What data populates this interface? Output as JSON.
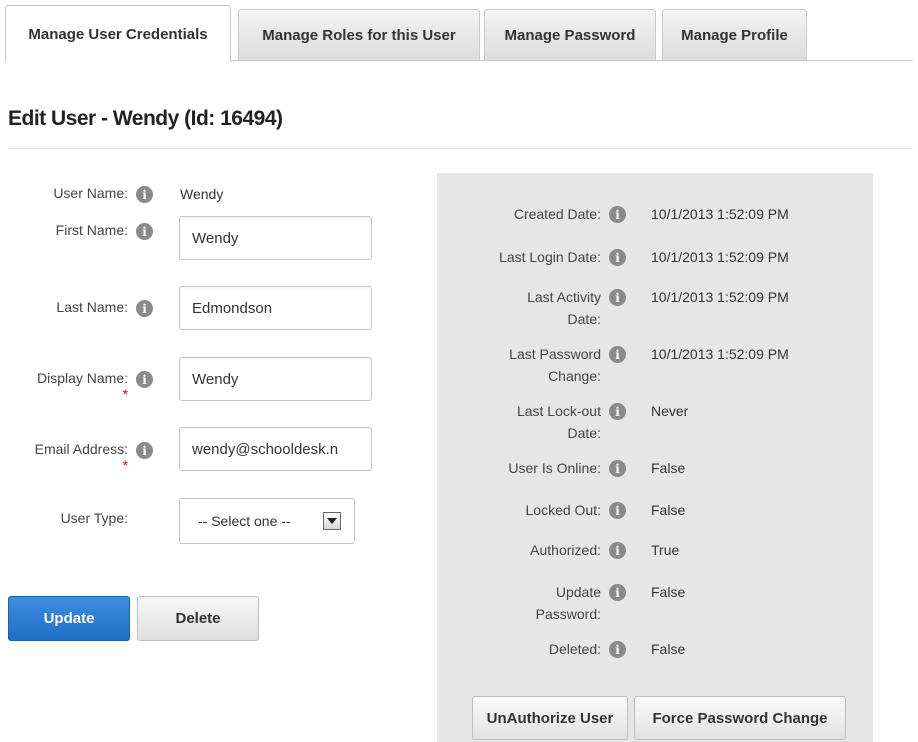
{
  "tabs": [
    {
      "label": "Manage User Credentials",
      "active": true
    },
    {
      "label": "Manage Roles for this User",
      "active": false
    },
    {
      "label": "Manage Password",
      "active": false
    },
    {
      "label": "Manage Profile",
      "active": false
    }
  ],
  "page_title": "Edit User - Wendy (Id: 16494)",
  "form": {
    "user_name": {
      "label": "User Name:",
      "value": "Wendy"
    },
    "first_name": {
      "label": "First Name:",
      "value": "Wendy"
    },
    "last_name": {
      "label": "Last Name:",
      "value": "Edmondson"
    },
    "display_name": {
      "label": "Display Name:",
      "value": "Wendy",
      "required": "*"
    },
    "email": {
      "label": "Email Address:",
      "value": "wendy@schooldesk.n",
      "required": "*"
    },
    "user_type": {
      "label": "User Type:",
      "selected": "-- Select one --"
    },
    "info_glyph": "i"
  },
  "actions": {
    "update": "Update",
    "delete": "Delete"
  },
  "details": {
    "created_date": {
      "label": "Created Date:",
      "value": "10/1/2013 1:52:09 PM"
    },
    "last_login_date": {
      "label": "Last Login Date:",
      "value": "10/1/2013 1:52:09 PM"
    },
    "last_activity_date": {
      "label_line1": "Last Activity",
      "label_line2": "Date:",
      "value": "10/1/2013 1:52:09 PM"
    },
    "last_password_change": {
      "label_line1": "Last Password",
      "label_line2": "Change:",
      "value": "10/1/2013 1:52:09 PM"
    },
    "last_lockout_date": {
      "label_line1": "Last Lock-out",
      "label_line2": "Date:",
      "value": "Never"
    },
    "user_is_online": {
      "label": "User Is Online:",
      "value": "False"
    },
    "locked_out": {
      "label": "Locked Out:",
      "value": "False"
    },
    "authorized": {
      "label": "Authorized:",
      "value": "True"
    },
    "update_password": {
      "label_line1": "Update",
      "label_line2": "Password:",
      "value": "False"
    },
    "deleted": {
      "label": "Deleted:",
      "value": "False"
    }
  },
  "panel_actions": {
    "unauthorize": "UnAuthorize User",
    "force_password": "Force Password Change"
  },
  "colors": {
    "primary": "#1f6fc7",
    "panel_bg": "#e6e6e6",
    "required": "#dd0000",
    "info_icon": "#8a8a8a"
  }
}
